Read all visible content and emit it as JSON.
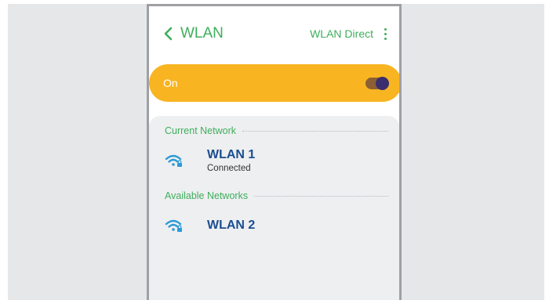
{
  "header": {
    "back_label": "WLAN",
    "wifi_direct_label": "WLAN Direct",
    "accent": "#3fae5c"
  },
  "master_switch": {
    "label": "On",
    "state": "on",
    "bar_color": "#f8b521"
  },
  "sections": {
    "current": "Current Network",
    "available": "Available Networks"
  },
  "networks": [
    {
      "name": "WLAN 1",
      "status": "Connected",
      "icon": "wifi-locked-icon"
    },
    {
      "name": "WLAN 2",
      "status": "",
      "icon": "wifi-locked-icon"
    }
  ]
}
